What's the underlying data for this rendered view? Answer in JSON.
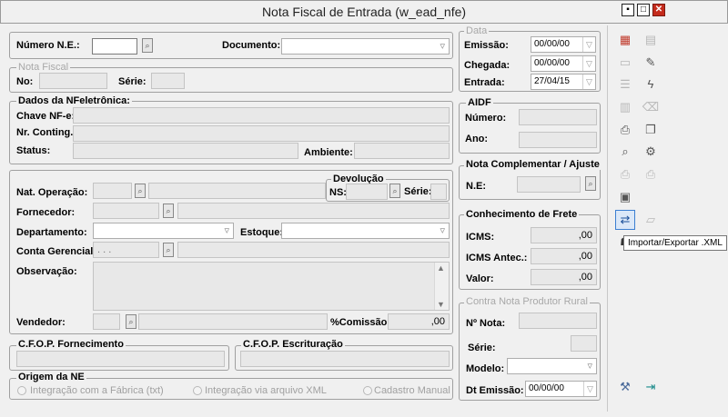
{
  "window": {
    "title": "Nota Fiscal de Entrada (w_ead_nfe)",
    "min": "▪",
    "max": "□",
    "close": "✕"
  },
  "top": {
    "numero_label": "Número N.E.:",
    "documento_label": "Documento:"
  },
  "nota_fiscal": {
    "legend": "Nota Fiscal",
    "no_label": "No:",
    "serie_label": "Série:"
  },
  "nfe": {
    "legend": "Dados da NFeletrônica:",
    "chave_label": "Chave NF-e:",
    "contingencia_label": "Nr. Conting.:",
    "status_label": "Status:",
    "ambiente_label": "Ambiente:"
  },
  "main": {
    "devolucao_legend": "Devolução",
    "ns_label": "NS:",
    "dserie_label": "Série:",
    "natop_label": "Nat. Operação:",
    "fornecedor_label": "Fornecedor:",
    "departamento_label": "Departamento:",
    "estoque_label": "Estoque:",
    "conta_label": "Conta Gerencial:",
    "conta_value": ". . .",
    "obs_label": "Observação:",
    "vendedor_label": "Vendedor:",
    "comissao_label": "%Comissão:",
    "comissao_value": ",00"
  },
  "cfop": {
    "fornecimento": "C.F.O.P. Fornecimento",
    "escrituracao": "C.F.O.P. Escrituração"
  },
  "origem": {
    "legend": "Origem da NE",
    "options": [
      "Integração com a Fábrica (txt)",
      "Integração via arquivo XML",
      "Cadastro Manual"
    ]
  },
  "datas": {
    "legend": "Data",
    "emissao_label": "Emissão:",
    "emissao_value": "00/00/00",
    "chegada_label": "Chegada:",
    "chegada_value": "00/00/00",
    "entrada_label": "Entrada:",
    "entrada_value": "27/04/15"
  },
  "aidf": {
    "legend": "AIDF",
    "numero_label": "Número:",
    "ano_label": "Ano:"
  },
  "complementar": {
    "legend": "Nota Complementar / Ajuste",
    "ne_label": "N.E:"
  },
  "frete": {
    "legend": "Conhecimento de Frete",
    "icms_label": "ICMS:",
    "icms_value": ",00",
    "icms_antec_label": "ICMS Antec.:",
    "icms_antec_value": ",00",
    "valor_label": "Valor:",
    "valor_value": ",00"
  },
  "contra": {
    "legend": "Contra Nota Produtor Rural",
    "nota_label": "Nº Nota:",
    "serie_label": "Série:",
    "modelo_label": "Modelo:",
    "emissao_label": "Dt Emissão:",
    "emissao_value": "00/00/00"
  },
  "toolbar": {
    "tooltip": "Importar/Exportar .XML",
    "icons": [
      "grid-add-icon",
      "list-icon",
      "preview-icon",
      "edit-icon",
      "doc-icon",
      "lightning-icon",
      "stack-icon",
      "trash-icon",
      "print-icon",
      "copy-icon",
      "find-icon",
      "settings-icon",
      "printer-icon",
      "printer2-icon",
      "report-icon",
      "import-export-icon",
      "folder-icon",
      "user-icon",
      "tools-icon",
      "exit-icon"
    ]
  }
}
